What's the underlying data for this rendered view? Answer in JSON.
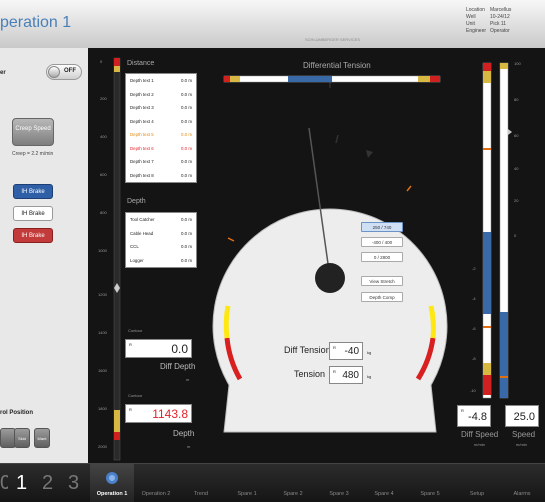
{
  "header": {
    "title": "peration 1",
    "center_text": "SCHLUMBERGER SERVICES",
    "info": [
      {
        "label": "Location",
        "value": "Marcellus"
      },
      {
        "label": "Well",
        "value": "10-24/12"
      },
      {
        "label": "Unit",
        "value": "Pick 11"
      },
      {
        "label": "Engineer",
        "value": "Operator"
      }
    ]
  },
  "left": {
    "toggle_label": "er",
    "toggle_value": "OFF",
    "creep_label": "Creep Speed",
    "creep_note": "Creep = 2.2 m/min",
    "brakes": [
      "IH Brake",
      "IH Brake",
      "IH Brake"
    ],
    "control_position": "rol Position",
    "small_buttons": [
      "",
      "Skid",
      "Mant"
    ]
  },
  "depth": {
    "distance_label": "Distance",
    "distance_items": [
      {
        "name": "Depth text 1",
        "value": "0.0 m",
        "state": "normal"
      },
      {
        "name": "Depth text 2",
        "value": "0.0 m",
        "state": "normal"
      },
      {
        "name": "Depth text 3",
        "value": "0.0 m",
        "state": "normal"
      },
      {
        "name": "Depth text 4",
        "value": "0.0 m",
        "state": "normal"
      },
      {
        "name": "Depth text 5",
        "value": "0.0 m",
        "state": "warning"
      },
      {
        "name": "Depth text 6",
        "value": "0.0 m",
        "state": "alarm"
      },
      {
        "name": "Depth text 7",
        "value": "0.0 m",
        "state": "normal"
      },
      {
        "name": "Depth text 8",
        "value": "0.0 m",
        "state": "normal"
      }
    ],
    "depth_label": "Depth",
    "depth_items": [
      {
        "name": "Tool Catcher",
        "value": "0.0 m"
      },
      {
        "name": "Cable Head",
        "value": "0.0 m"
      },
      {
        "name": "CCL",
        "value": "0.0 m"
      },
      {
        "name": "Logger",
        "value": "0.0 m"
      }
    ],
    "scale": [
      "0",
      "200",
      "400",
      "600",
      "800",
      "1000",
      "1200",
      "1400",
      "1600",
      "1800",
      "2000"
    ],
    "diff_depth_caption": "Contour",
    "diff_depth_value": "0.0",
    "diff_depth_label": "Diff Depth",
    "diff_depth_unit": "m",
    "depth_caption": "Contour",
    "depth_value": "1143.8",
    "depth_big_label": "Depth",
    "depth_unit": "m"
  },
  "center": {
    "diff_tension_title": "Differential Tension",
    "buttons": [
      "250 / 740",
      "-400 / 400",
      "0 / 2800",
      "View Stretch",
      "Depth Comp"
    ],
    "diff_tension_label": "Diff Tension",
    "diff_tension_value": "-40",
    "diff_tension_unit": "kg",
    "tension_label": "Tension",
    "tension_value": "480",
    "tension_unit": "kg"
  },
  "right": {
    "scale": [
      "100",
      "80",
      "60",
      "40",
      "20",
      "0",
      "-2",
      "-4",
      "-6",
      "-8",
      "-10"
    ],
    "diff_speed_value": "-4.8",
    "diff_speed_label": "Diff Speed",
    "diff_speed_unit": "m/min",
    "speed_value": "25.0",
    "speed_label": "Speed",
    "speed_unit": "m/min"
  },
  "bottom": {
    "pages": [
      "1",
      "2",
      "3"
    ],
    "tabs": [
      "Operation 1",
      "Operation 2",
      "Trend",
      "Spare 1",
      "Spare 2",
      "Spare 3",
      "Spare 4",
      "Spare 5",
      "Setup",
      "Alarms"
    ]
  }
}
